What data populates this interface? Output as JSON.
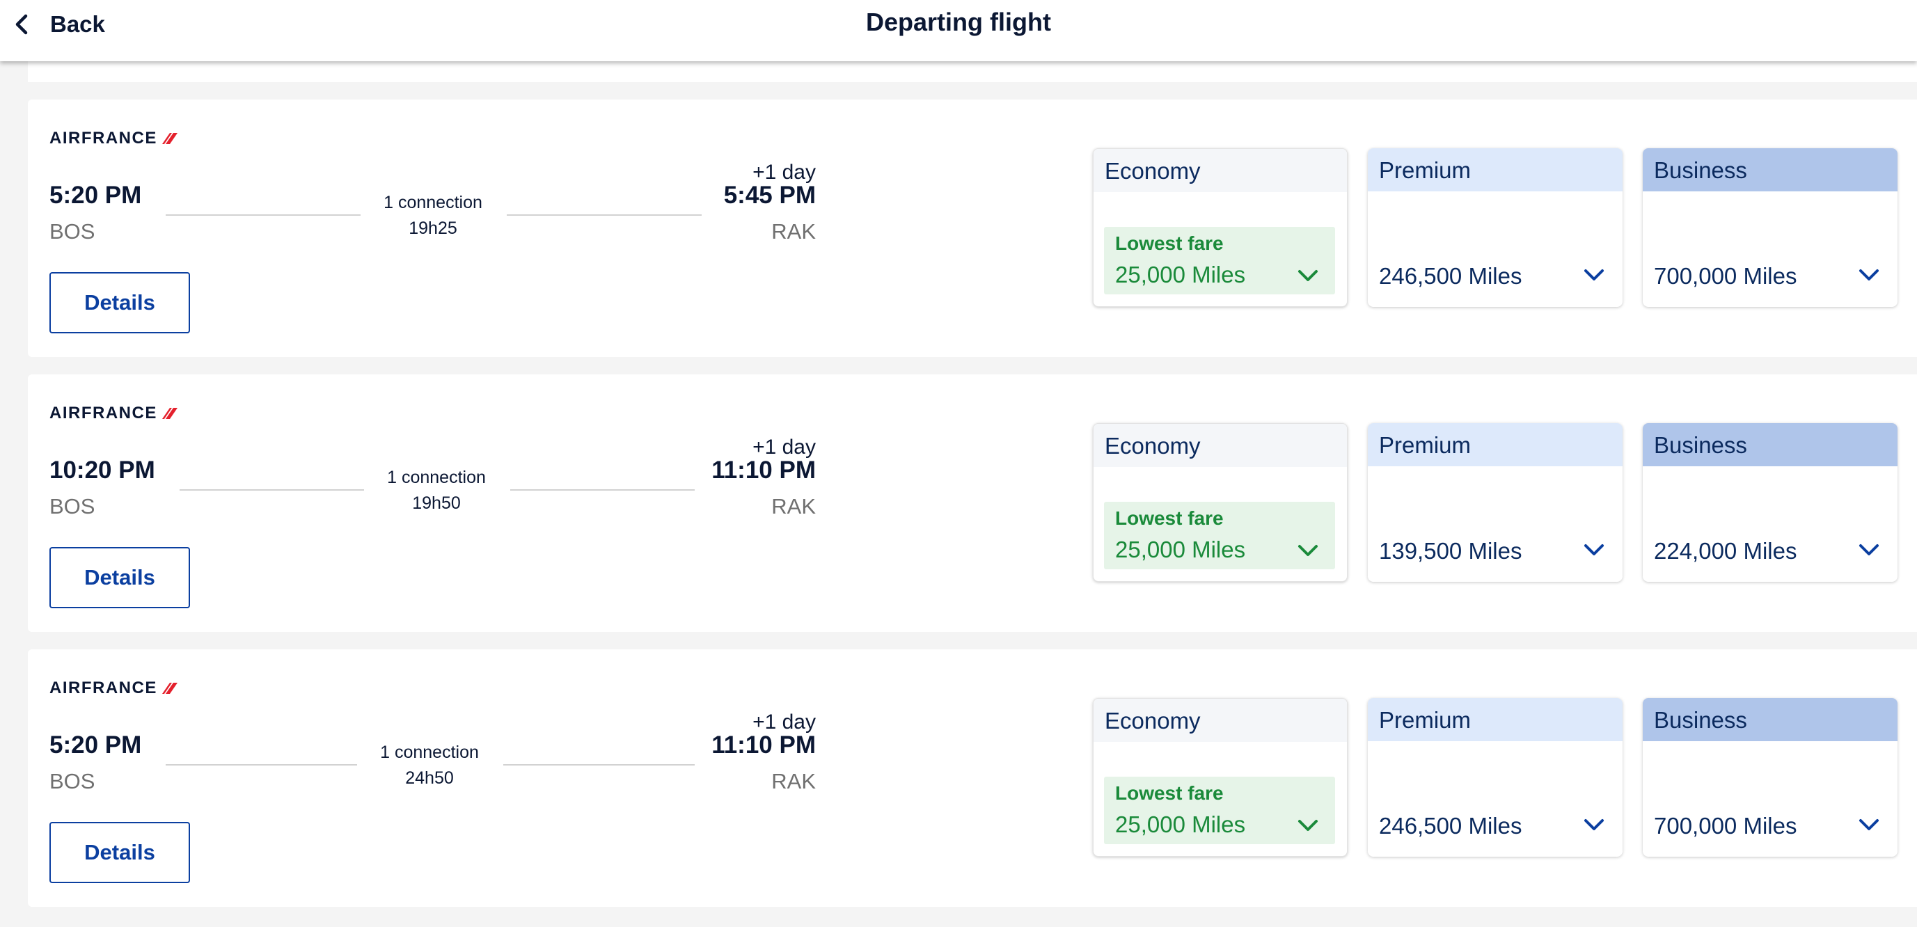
{
  "header": {
    "back_label": "Back",
    "title": "Departing flight"
  },
  "colors": {
    "navy": "#0b1733",
    "link_blue": "#0b3fa0",
    "fare_text": "#0b2a5e",
    "lowest_green": "#1a8a3a",
    "lowest_bg": "#e6f4e8",
    "economy_header": "#f4f6f9",
    "premium_header": "#dde9fb",
    "business_header": "#afc5ea",
    "brand_red": "#e4202c"
  },
  "flights": [
    {
      "airline": "AIRFRANCE",
      "depart_time": "5:20 PM",
      "depart_code": "BOS",
      "connection": "1 connection",
      "duration": "19h25",
      "day_offset": "+1 day",
      "arrive_time": "5:45 PM",
      "arrive_code": "RAK",
      "details_label": "Details",
      "fares": {
        "economy": {
          "label": "Economy",
          "tag": "Lowest fare",
          "price": "25,000 Miles"
        },
        "premium": {
          "label": "Premium",
          "price": "246,500 Miles"
        },
        "business": {
          "label": "Business",
          "price": "700,000 Miles"
        }
      }
    },
    {
      "airline": "AIRFRANCE",
      "depart_time": "10:20 PM",
      "depart_code": "BOS",
      "connection": "1 connection",
      "duration": "19h50",
      "day_offset": "+1 day",
      "arrive_time": "11:10 PM",
      "arrive_code": "RAK",
      "details_label": "Details",
      "fares": {
        "economy": {
          "label": "Economy",
          "tag": "Lowest fare",
          "price": "25,000 Miles"
        },
        "premium": {
          "label": "Premium",
          "price": "139,500 Miles"
        },
        "business": {
          "label": "Business",
          "price": "224,000 Miles"
        }
      }
    },
    {
      "airline": "AIRFRANCE",
      "depart_time": "5:20 PM",
      "depart_code": "BOS",
      "connection": "1 connection",
      "duration": "24h50",
      "day_offset": "+1 day",
      "arrive_time": "11:10 PM",
      "arrive_code": "RAK",
      "details_label": "Details",
      "fares": {
        "economy": {
          "label": "Economy",
          "tag": "Lowest fare",
          "price": "25,000 Miles"
        },
        "premium": {
          "label": "Premium",
          "price": "246,500 Miles"
        },
        "business": {
          "label": "Business",
          "price": "700,000 Miles"
        }
      }
    }
  ]
}
